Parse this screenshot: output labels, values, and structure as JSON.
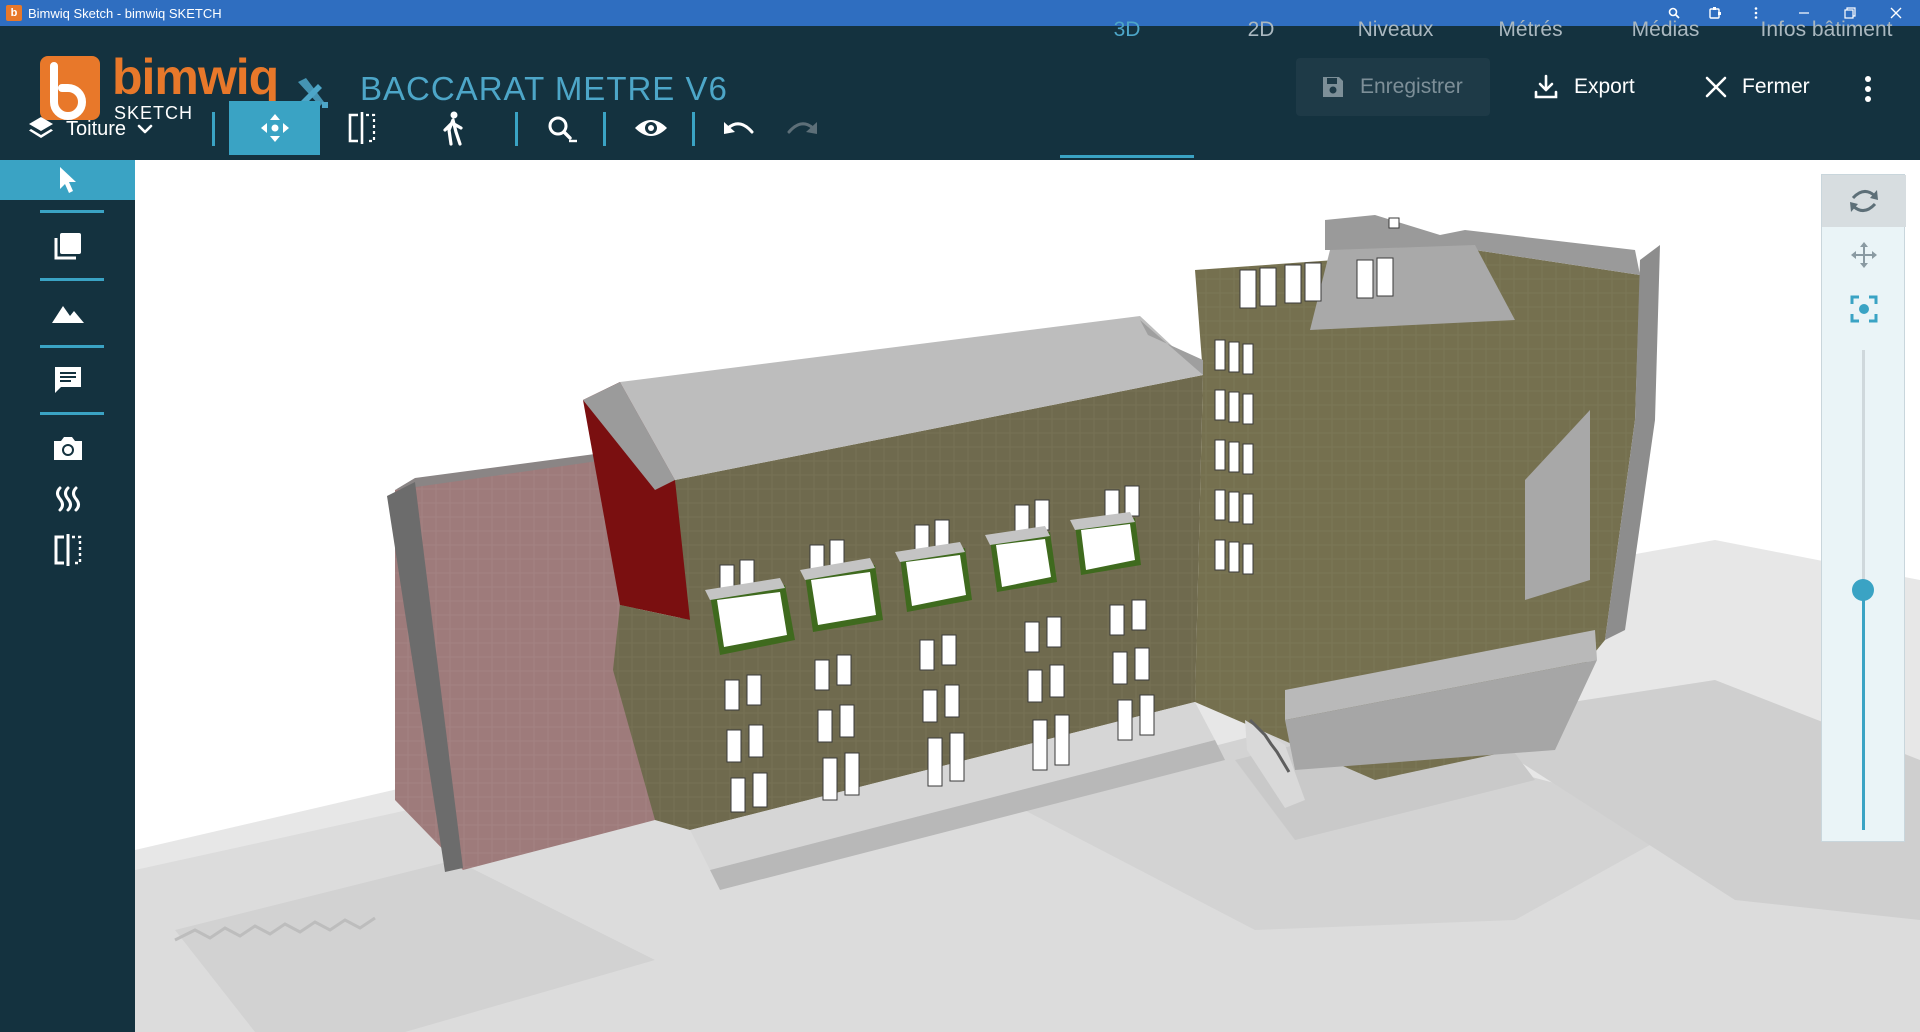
{
  "window": {
    "title": "Bimwiq Sketch - bimwiq SKETCH",
    "app_icon_letter": "b",
    "controls": [
      "zoom-icon",
      "extension-icon",
      "more-vert-icon",
      "minimize-icon",
      "restore-icon",
      "close-icon"
    ]
  },
  "header": {
    "logo_word": "bimwiq",
    "logo_sub": "SKETCH",
    "project_title": "BACCARAT METRE V6",
    "save_label": "Enregistrer",
    "export_label": "Export",
    "close_label": "Fermer"
  },
  "toolbar": {
    "layer_label": "Toiture",
    "tools": [
      "move-tool-icon",
      "section-tool-icon",
      "walk-tool-icon",
      "measure-zoom-icon",
      "visibility-icon",
      "undo-icon",
      "redo-icon"
    ]
  },
  "tabs": [
    {
      "label": "3D",
      "active": true
    },
    {
      "label": "2D",
      "active": false
    },
    {
      "label": "Niveaux",
      "active": false
    },
    {
      "label": "Métrés",
      "active": false
    },
    {
      "label": "Médias",
      "active": false
    },
    {
      "label": "Infos bâtiment",
      "active": false
    }
  ],
  "sidebar": {
    "items": [
      "cursor-icon",
      "layers-copy-icon",
      "terrain-icon",
      "comment-icon",
      "camera-icon",
      "heat-icon",
      "section-icon"
    ]
  },
  "nav_panel": {
    "buttons": [
      "orbit-icon",
      "pan-icon",
      "fit-view-icon"
    ],
    "zoom_level": 0.5
  },
  "colors": {
    "header_bg": "#14323f",
    "accent": "#3aa3c4",
    "brand": "#e8782a",
    "titlebar": "#2f6ec0",
    "facade": "#6f6a4e",
    "brick": "#9e7b7b",
    "red_wall": "#7a0f10",
    "bay_frame": "#3f6a1e"
  }
}
